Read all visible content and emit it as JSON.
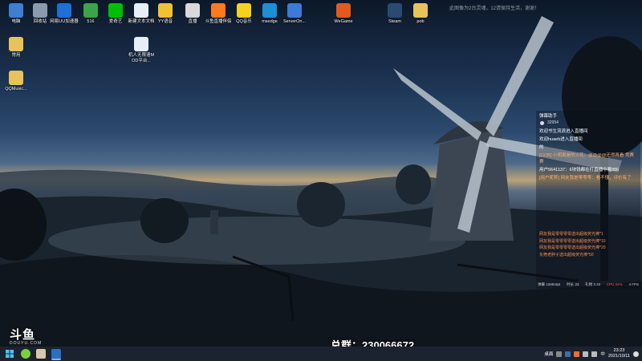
{
  "desktop": {
    "icons": [
      {
        "label": "电脑",
        "icon": "computer-icon",
        "color": "#3d7fd1"
      },
      {
        "label": "回收站",
        "icon": "recycle-bin-icon",
        "color": "#8a9bb0"
      },
      {
        "label": "网易UU加速器",
        "icon": "uu-booster-icon",
        "color": "#1f6fd8"
      },
      {
        "label": "516",
        "icon": "notebook-icon",
        "color": "#3ba34a"
      },
      {
        "label": "爱奇艺",
        "icon": "iqiyi-icon",
        "color": "#00be06"
      },
      {
        "label": "新建文本文档",
        "icon": "text-document-icon",
        "color": "#e8eef5"
      },
      {
        "label": "YY语音",
        "icon": "yy-voice-icon",
        "color": "#f2c233"
      },
      {
        "label": "直播",
        "icon": "live-folder-icon",
        "color": "#d9d9d9"
      },
      {
        "label": "斗鱼直播伴侣",
        "icon": "douyu-companion-icon",
        "color": "#ff7a1a"
      },
      {
        "label": "QQ音乐",
        "icon": "qq-music-icon",
        "color": "#f7d21c"
      },
      {
        "label": "msedge",
        "icon": "edge-icon",
        "color": "#1c8fd6"
      },
      {
        "label": "ServerOn...",
        "icon": "server-app-icon",
        "color": "#3a7bd5"
      },
      {
        "label": "WeGame",
        "icon": "wegame-icon",
        "color": "#e35a1f"
      },
      {
        "label": "Steam",
        "icon": "steam-icon",
        "color": "#2a4a73"
      },
      {
        "label": "pob",
        "icon": "folder-icon",
        "color": "#e8c25a"
      },
      {
        "label": "常用",
        "icon": "folder-icon",
        "color": "#e8c25a"
      },
      {
        "label": "机人无限速MOD平台...",
        "icon": "document-icon",
        "color": "#e8eef5"
      },
      {
        "label": "QQMusic...",
        "icon": "folder-icon",
        "color": "#e8c25a"
      }
    ],
    "watermark": "此图像为2台灵魂，12请保持生活，谢谢！"
  },
  "chat": {
    "title": "弹幕助手",
    "viewers": "32954",
    "messages": [
      {
        "text": "欢迎书生流浪进入直播间",
        "hl": false
      },
      {
        "text": "欢迎huaeb进入直播间",
        "hl": false
      },
      {
        "text": "的",
        "hl": false
      },
      {
        "text": "[LV35] 小明真是的火花：@@@@还得再看 竞赛赛",
        "hl": true
      },
      {
        "text": "用户5641137：6块钱都在打直播中喔886",
        "hl": false
      },
      {
        "text": "[用户昵称] 网友我是零零零：看不懂，评价有了",
        "hl": true
      }
    ],
    "gifts": [
      "网友我是零零零零送出超级荧光棒*1",
      "网友我是零零零零送出超级荧光棒*10",
      "网友我是零零零零送出超级荧光棒*20",
      "东莞老胖子送出超级荧光棒*50"
    ],
    "stats": {
      "a": "弹幕 10994&5",
      "b": "时长 33",
      "c": "礼物 3.33",
      "d": "CPU 24%",
      "e": "4 FPS"
    }
  },
  "overlay": {
    "douyu_logo": "斗鱼",
    "douyu_sub": "DOUYU.COM",
    "group_text": "总群：230066672"
  },
  "taskbar": {
    "tray_label": "桌面",
    "time": "23:23",
    "date": "2021/10/11",
    "lang": "中"
  }
}
